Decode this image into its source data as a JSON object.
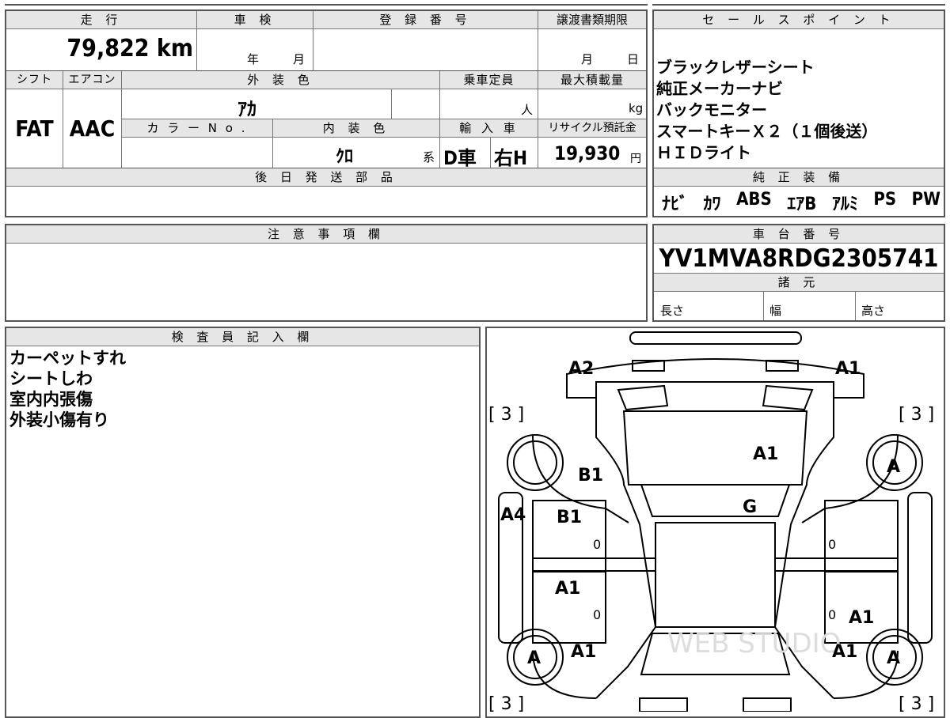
{
  "top_form": {
    "headers": {
      "mileage": "走 行",
      "shaken": "車 検",
      "reg_number": "登 録 番 号",
      "transfer_deadline": "譲渡書類期限",
      "shift": "シフト",
      "aircon": "エアコン",
      "ext_color": "外 装 色",
      "capacity": "乗車定員",
      "max_load": "最大積載量",
      "color_no": "カ ラ ー N o .",
      "int_color": "内 装 色",
      "import": "輸 入 車",
      "recycle": "リサイクル預託金",
      "later_parts": "後 日 発 送 部 品"
    },
    "mileage_value": "79,822 km",
    "shaken_year_unit": "年",
    "shaken_month_unit": "月",
    "deadline_month_unit": "月",
    "deadline_day_unit": "日",
    "shift_value": "FAT",
    "aircon_value": "AAC",
    "ext_color_value": "ｱｶ",
    "capacity_unit": "人",
    "load_unit": "kg",
    "int_color_value": "ｸﾛ",
    "int_color_suffix": "系",
    "import_drive": "D車",
    "import_handle": "右H",
    "recycle_value": "19,930",
    "recycle_unit": "円"
  },
  "sales_points": {
    "header": "セ ー ル ス ポ イ ン ト",
    "lines": [
      "ブラックレザーシート",
      "純正メーカーナビ",
      "バックモニター",
      "スマートキーＸ２（１個後送）",
      "ＨＩＤライト"
    ],
    "equipment_header": "純 正 装 備",
    "equipment": [
      "ﾅﾋﾞ",
      "ｶﾜ",
      "ABS",
      "ｴｱB",
      "ｱﾙﾐ",
      "PS",
      "PW"
    ]
  },
  "notes": {
    "header": "注 意 事 項 欄"
  },
  "chassis": {
    "header": "車 台 番 号",
    "vin": "YV1MVA8RDG2305741",
    "specs_header": "諸 元",
    "length": "長さ",
    "width": "幅",
    "height": "高さ"
  },
  "inspector": {
    "header": "検 査 員 記 入 欄",
    "lines": [
      "カーペットすれ",
      "シートしわ",
      "室内内張傷",
      "外装小傷有り"
    ]
  },
  "diagram": {
    "watermark": "WEB STUDIO",
    "marks": {
      "front_left": "A2",
      "front_right": "A1",
      "tire_fl": "[ 3 ]",
      "tire_fr": "[ 3 ]",
      "tire_rl": "[ 3 ]",
      "tire_rr": "[ 3 ]",
      "hood": "A1",
      "fender_left": "B1",
      "windshield": "G",
      "wheel_fr": "A",
      "wheel_rl": "A",
      "wheel_rr": "A",
      "pillar_left": "A4",
      "door_fl": "B1",
      "door_rl": "A1",
      "rear_right": "A1",
      "quarter_left": "A1",
      "quarter_right": "A1",
      "zero_fl": "0",
      "zero_rl": "0",
      "zero_fr": "0",
      "zero_rr": "0"
    }
  }
}
